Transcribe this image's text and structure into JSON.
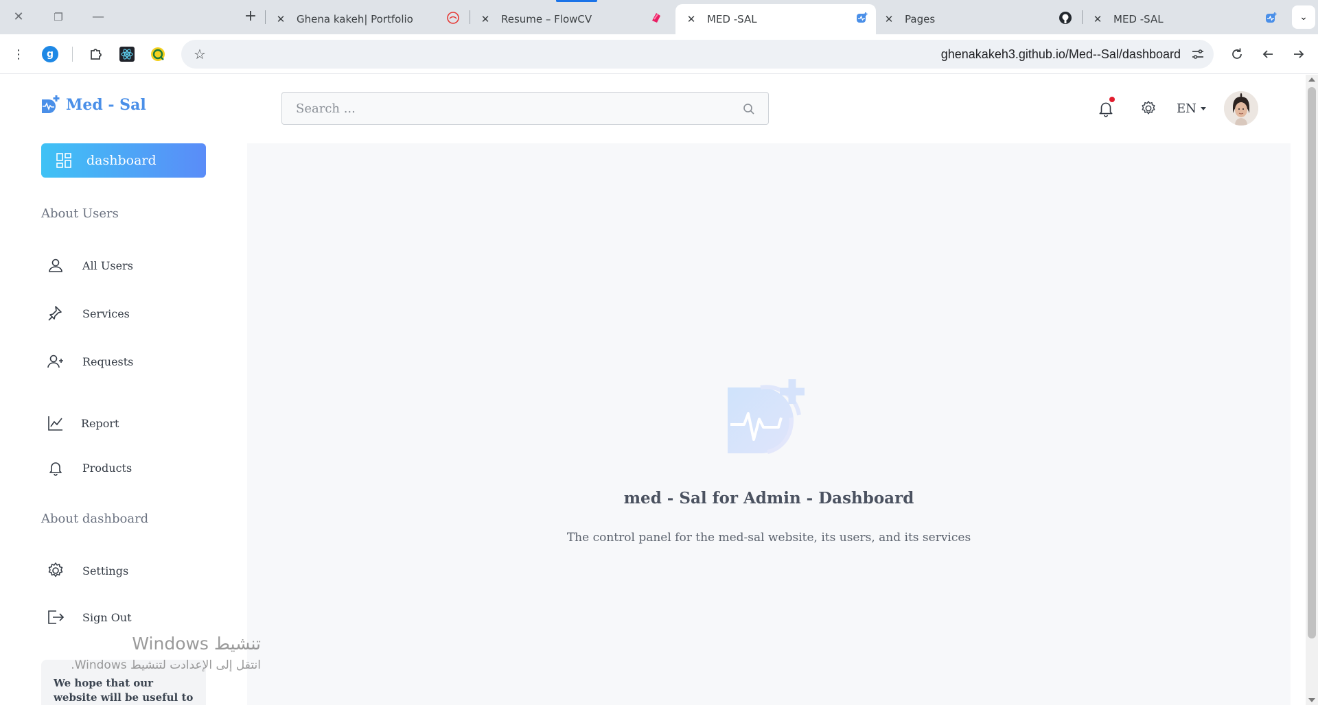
{
  "browser": {
    "tabs": [
      {
        "title": "Ghena kakeh| Portfolio",
        "icon": "portfolio-favicon"
      },
      {
        "title": "Resume – FlowCV",
        "icon": "flowcv-favicon"
      },
      {
        "title": "MED -SAL",
        "icon": "med-sal-favicon",
        "active": true
      },
      {
        "title": "Pages",
        "icon": "github-favicon"
      },
      {
        "title": "MED -SAL",
        "icon": "med-sal-favicon"
      }
    ],
    "url": "ghenakakeh3.github.io/Med--Sal/dashboard",
    "profile_initial": "g",
    "accent": "#1a73e8"
  },
  "sidebar": {
    "brand": "Med - Sal",
    "dashboard_label": "dashboard",
    "sections": {
      "users_title": "About Users",
      "dashboard_title": "About dashboard"
    },
    "items": [
      {
        "label": "All Users",
        "icon": "user-icon"
      },
      {
        "label": "Services",
        "icon": "pin-icon"
      },
      {
        "label": "Requests",
        "icon": "user-plus-icon"
      },
      {
        "label": "Report",
        "icon": "chart-line-icon"
      },
      {
        "label": "Products",
        "icon": "bell-icon"
      },
      {
        "label": "Settings",
        "icon": "gear-icon"
      },
      {
        "label": "Sign Out",
        "icon": "sign-out-icon"
      }
    ],
    "promo_text": "We hope that our website will be useful to you and we"
  },
  "header": {
    "search_placeholder": "Search ...",
    "language": "EN",
    "notification_dot_color": "#e11d2e"
  },
  "main": {
    "title": "med - Sal for Admin - Dashboard",
    "subtitle": "The control panel for the med-sal website, its users, and its services"
  },
  "overlay": {
    "activate_windows": "تنشيط Windows",
    "activate_hint": "انتقل إلى الإعدادت لتنشيط Windows."
  },
  "colors": {
    "brand_blue": "#4a8fe8",
    "gradient_start": "#3fc2f5",
    "gradient_end": "#5a8cf8",
    "main_bg": "#f7f8fa"
  }
}
